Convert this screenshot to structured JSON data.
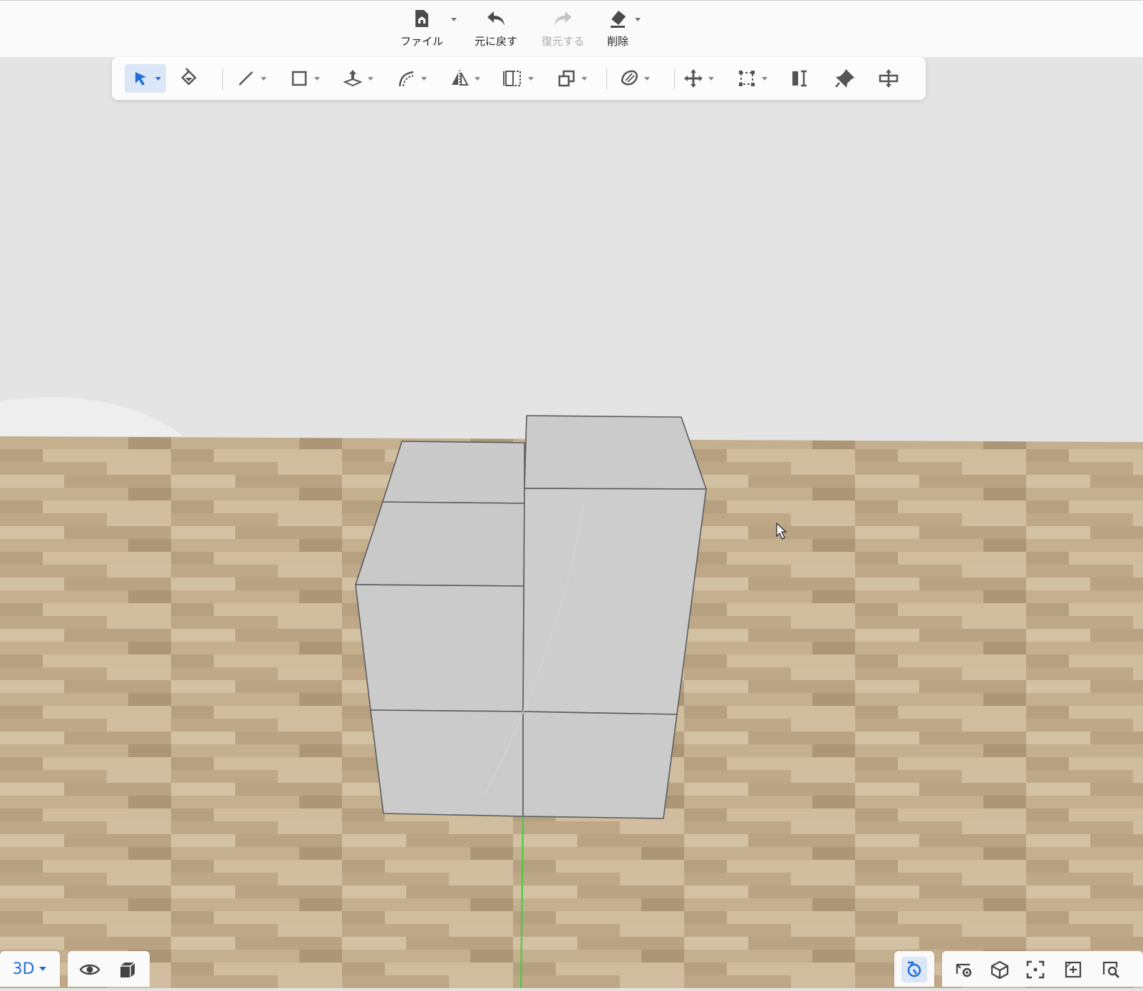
{
  "topbar": {
    "file_label": "ファイル",
    "undo_label": "元に戻す",
    "redo_label": "復元する",
    "delete_label": "削除"
  },
  "toolbar": {
    "tools": [
      {
        "name": "select",
        "active": true,
        "dropdown": true
      },
      {
        "name": "paint-bucket",
        "active": false,
        "dropdown": false
      },
      {
        "name": "line",
        "active": false,
        "dropdown": true
      },
      {
        "name": "rectangle",
        "active": false,
        "dropdown": true
      },
      {
        "name": "push-pull",
        "active": false,
        "dropdown": true
      },
      {
        "name": "offset-curve",
        "active": false,
        "dropdown": true
      },
      {
        "name": "mirror",
        "active": false,
        "dropdown": true
      },
      {
        "name": "array",
        "active": false,
        "dropdown": true
      },
      {
        "name": "copy-group",
        "active": false,
        "dropdown": true
      },
      {
        "name": "material",
        "active": false,
        "dropdown": true
      },
      {
        "name": "move",
        "active": false,
        "dropdown": true
      },
      {
        "name": "scale",
        "active": false,
        "dropdown": true
      },
      {
        "name": "dimension",
        "active": false,
        "dropdown": false
      },
      {
        "name": "pin",
        "active": false,
        "dropdown": false
      },
      {
        "name": "transform",
        "active": false,
        "dropdown": false
      }
    ]
  },
  "bottom": {
    "view_mode": "3D",
    "right_tools": [
      "orbit",
      "view-settings",
      "cube-view",
      "focus",
      "zoom-window",
      "zoom-search"
    ]
  },
  "colors": {
    "accent": "#1e6fd9",
    "icon": "#555555",
    "floor": "#c7b394",
    "box": "#cbcbcb",
    "edge": "#5c5c5c",
    "axis": "#3ad13a"
  }
}
